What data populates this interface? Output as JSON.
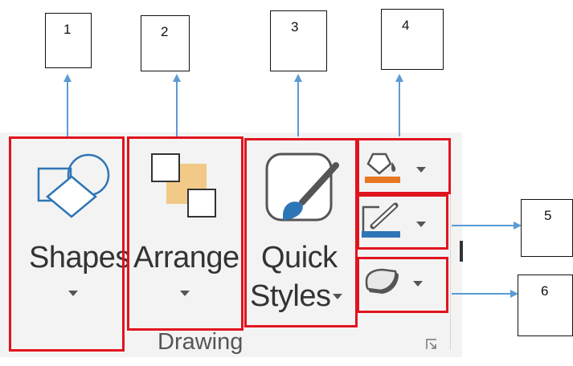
{
  "ribbon": {
    "shapes": {
      "label": "Shapes",
      "icon": "shapes-icon"
    },
    "arrange": {
      "label": "Arrange",
      "icon": "arrange-icon"
    },
    "quick_styles": {
      "label_line1": "Quick",
      "label_line2": "Styles",
      "icon": "quick-styles-icon"
    },
    "shape_fill": {
      "icon": "paint-bucket-icon",
      "color": "#e87722"
    },
    "shape_outline": {
      "icon": "pencil-icon",
      "color": "#2e75b6"
    },
    "shape_effects": {
      "icon": "eraser-icon"
    },
    "group_label": "Drawing"
  },
  "callouts": [
    "1",
    "2",
    "3",
    "4",
    "5",
    "6"
  ],
  "colors": {
    "highlight": "#e0141e",
    "arrow": "#5b9bd5",
    "accent_blue": "#2e75b6",
    "accent_orange": "#e87722"
  }
}
